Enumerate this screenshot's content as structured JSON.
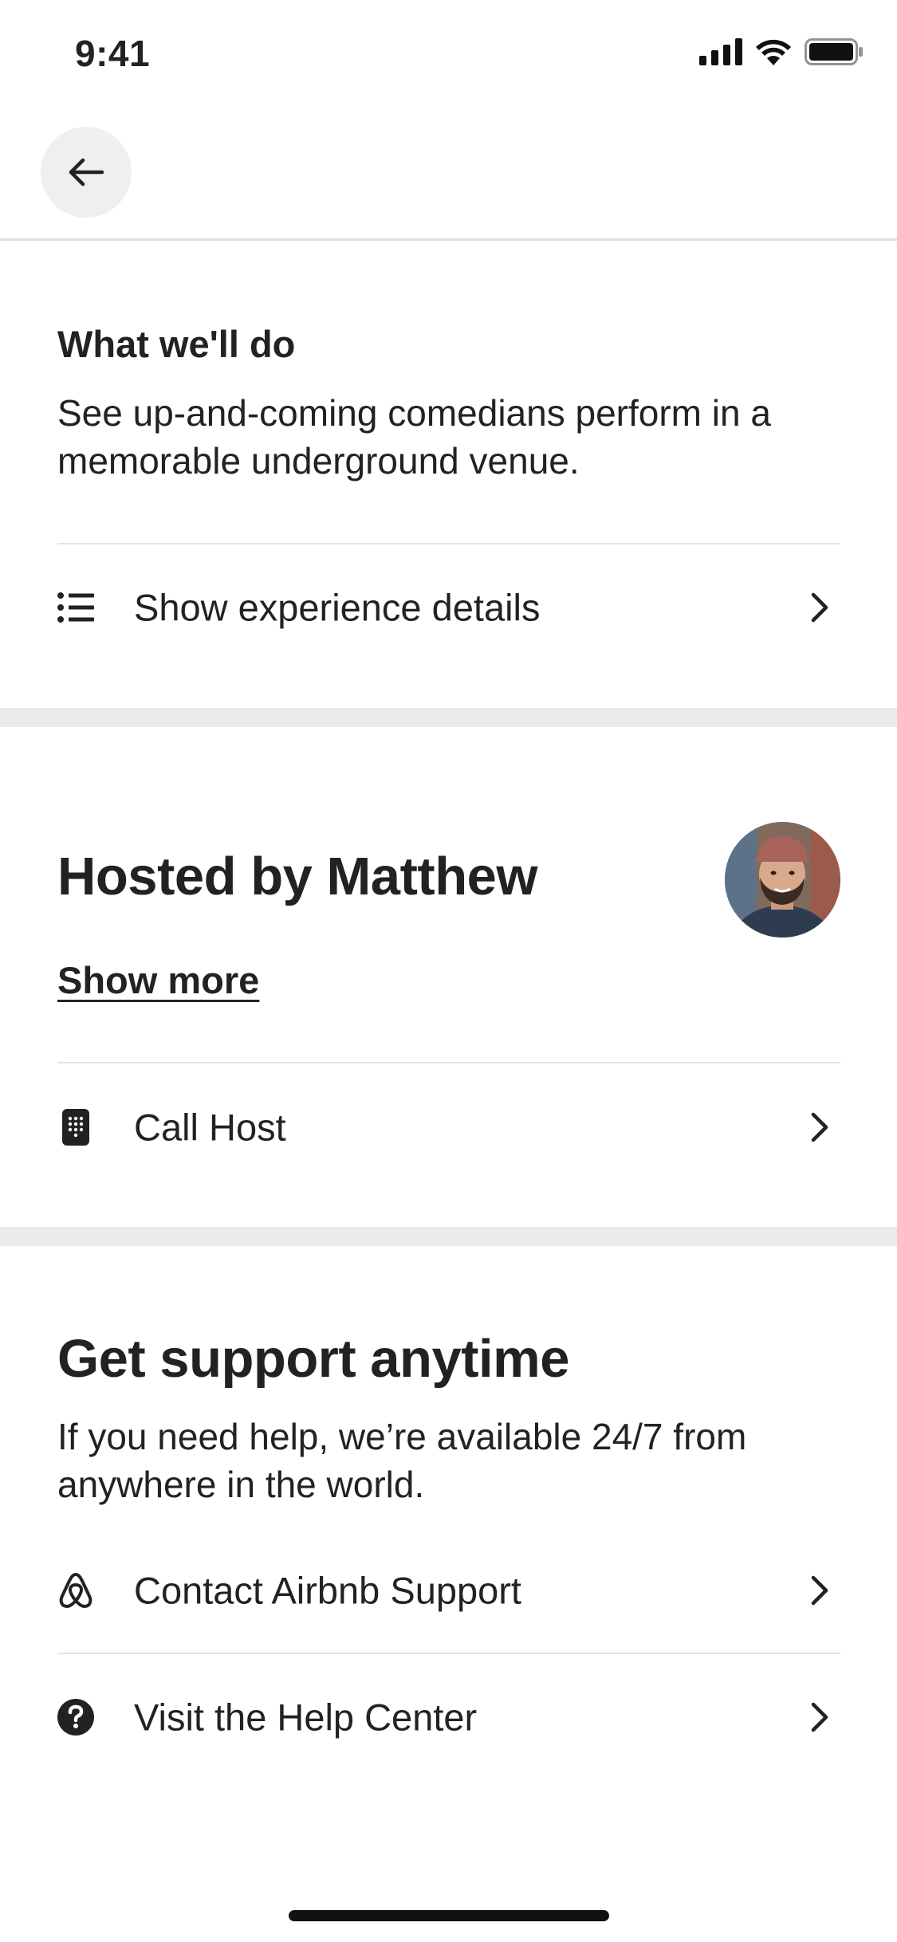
{
  "status_bar": {
    "time": "9:41"
  },
  "header": {
    "back_icon": "arrow-left-icon"
  },
  "what_we_do": {
    "title": "What we'll do",
    "description_line1": "See up-and-coming comedians perform in a",
    "description_line2": "memorable underground venue.",
    "details_row": {
      "icon": "list-icon",
      "label": "Show experience details"
    }
  },
  "host": {
    "title": "Hosted by Matthew",
    "show_more_label": "Show more",
    "call_row": {
      "icon": "phone-keypad-icon",
      "label": "Call Host"
    }
  },
  "support": {
    "title": "Get support anytime",
    "description_line1": "If you need help, we’re available 24/7 from",
    "description_line2": "anywhere in the world.",
    "rows": [
      {
        "icon": "airbnb-logo-icon",
        "label": "Contact Airbnb Support"
      },
      {
        "icon": "help-circle-icon",
        "label": "Visit the Help Center"
      }
    ]
  },
  "colors": {
    "text": "#222222",
    "divider": "#ebebeb",
    "back_button_bg": "#efefef"
  }
}
